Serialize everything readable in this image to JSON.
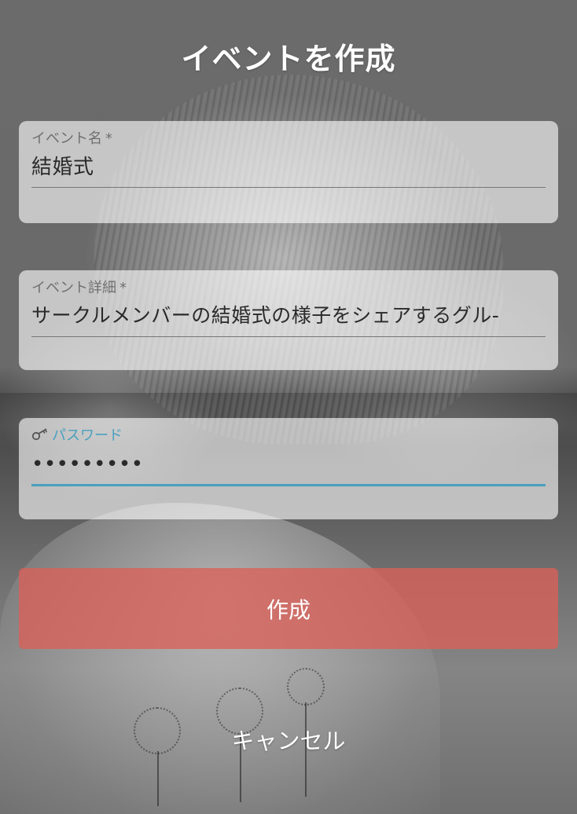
{
  "header": {
    "title": "イベントを作成"
  },
  "form": {
    "event_name": {
      "label": "イベント名",
      "required_mark": "*",
      "value": "結婚式"
    },
    "event_detail": {
      "label": "イベント詳細",
      "required_mark": "*",
      "value": "サークルメンバーの結婚式の様子をシェアするグル-"
    },
    "password": {
      "label": "パスワード",
      "icon": "key-icon",
      "value_masked": "•••••••••"
    }
  },
  "actions": {
    "create_label": "作成",
    "cancel_label": "キャンセル"
  },
  "colors": {
    "accent": "#4a9fbf",
    "create_button": "#da6058",
    "title_text": "#ffffff"
  }
}
